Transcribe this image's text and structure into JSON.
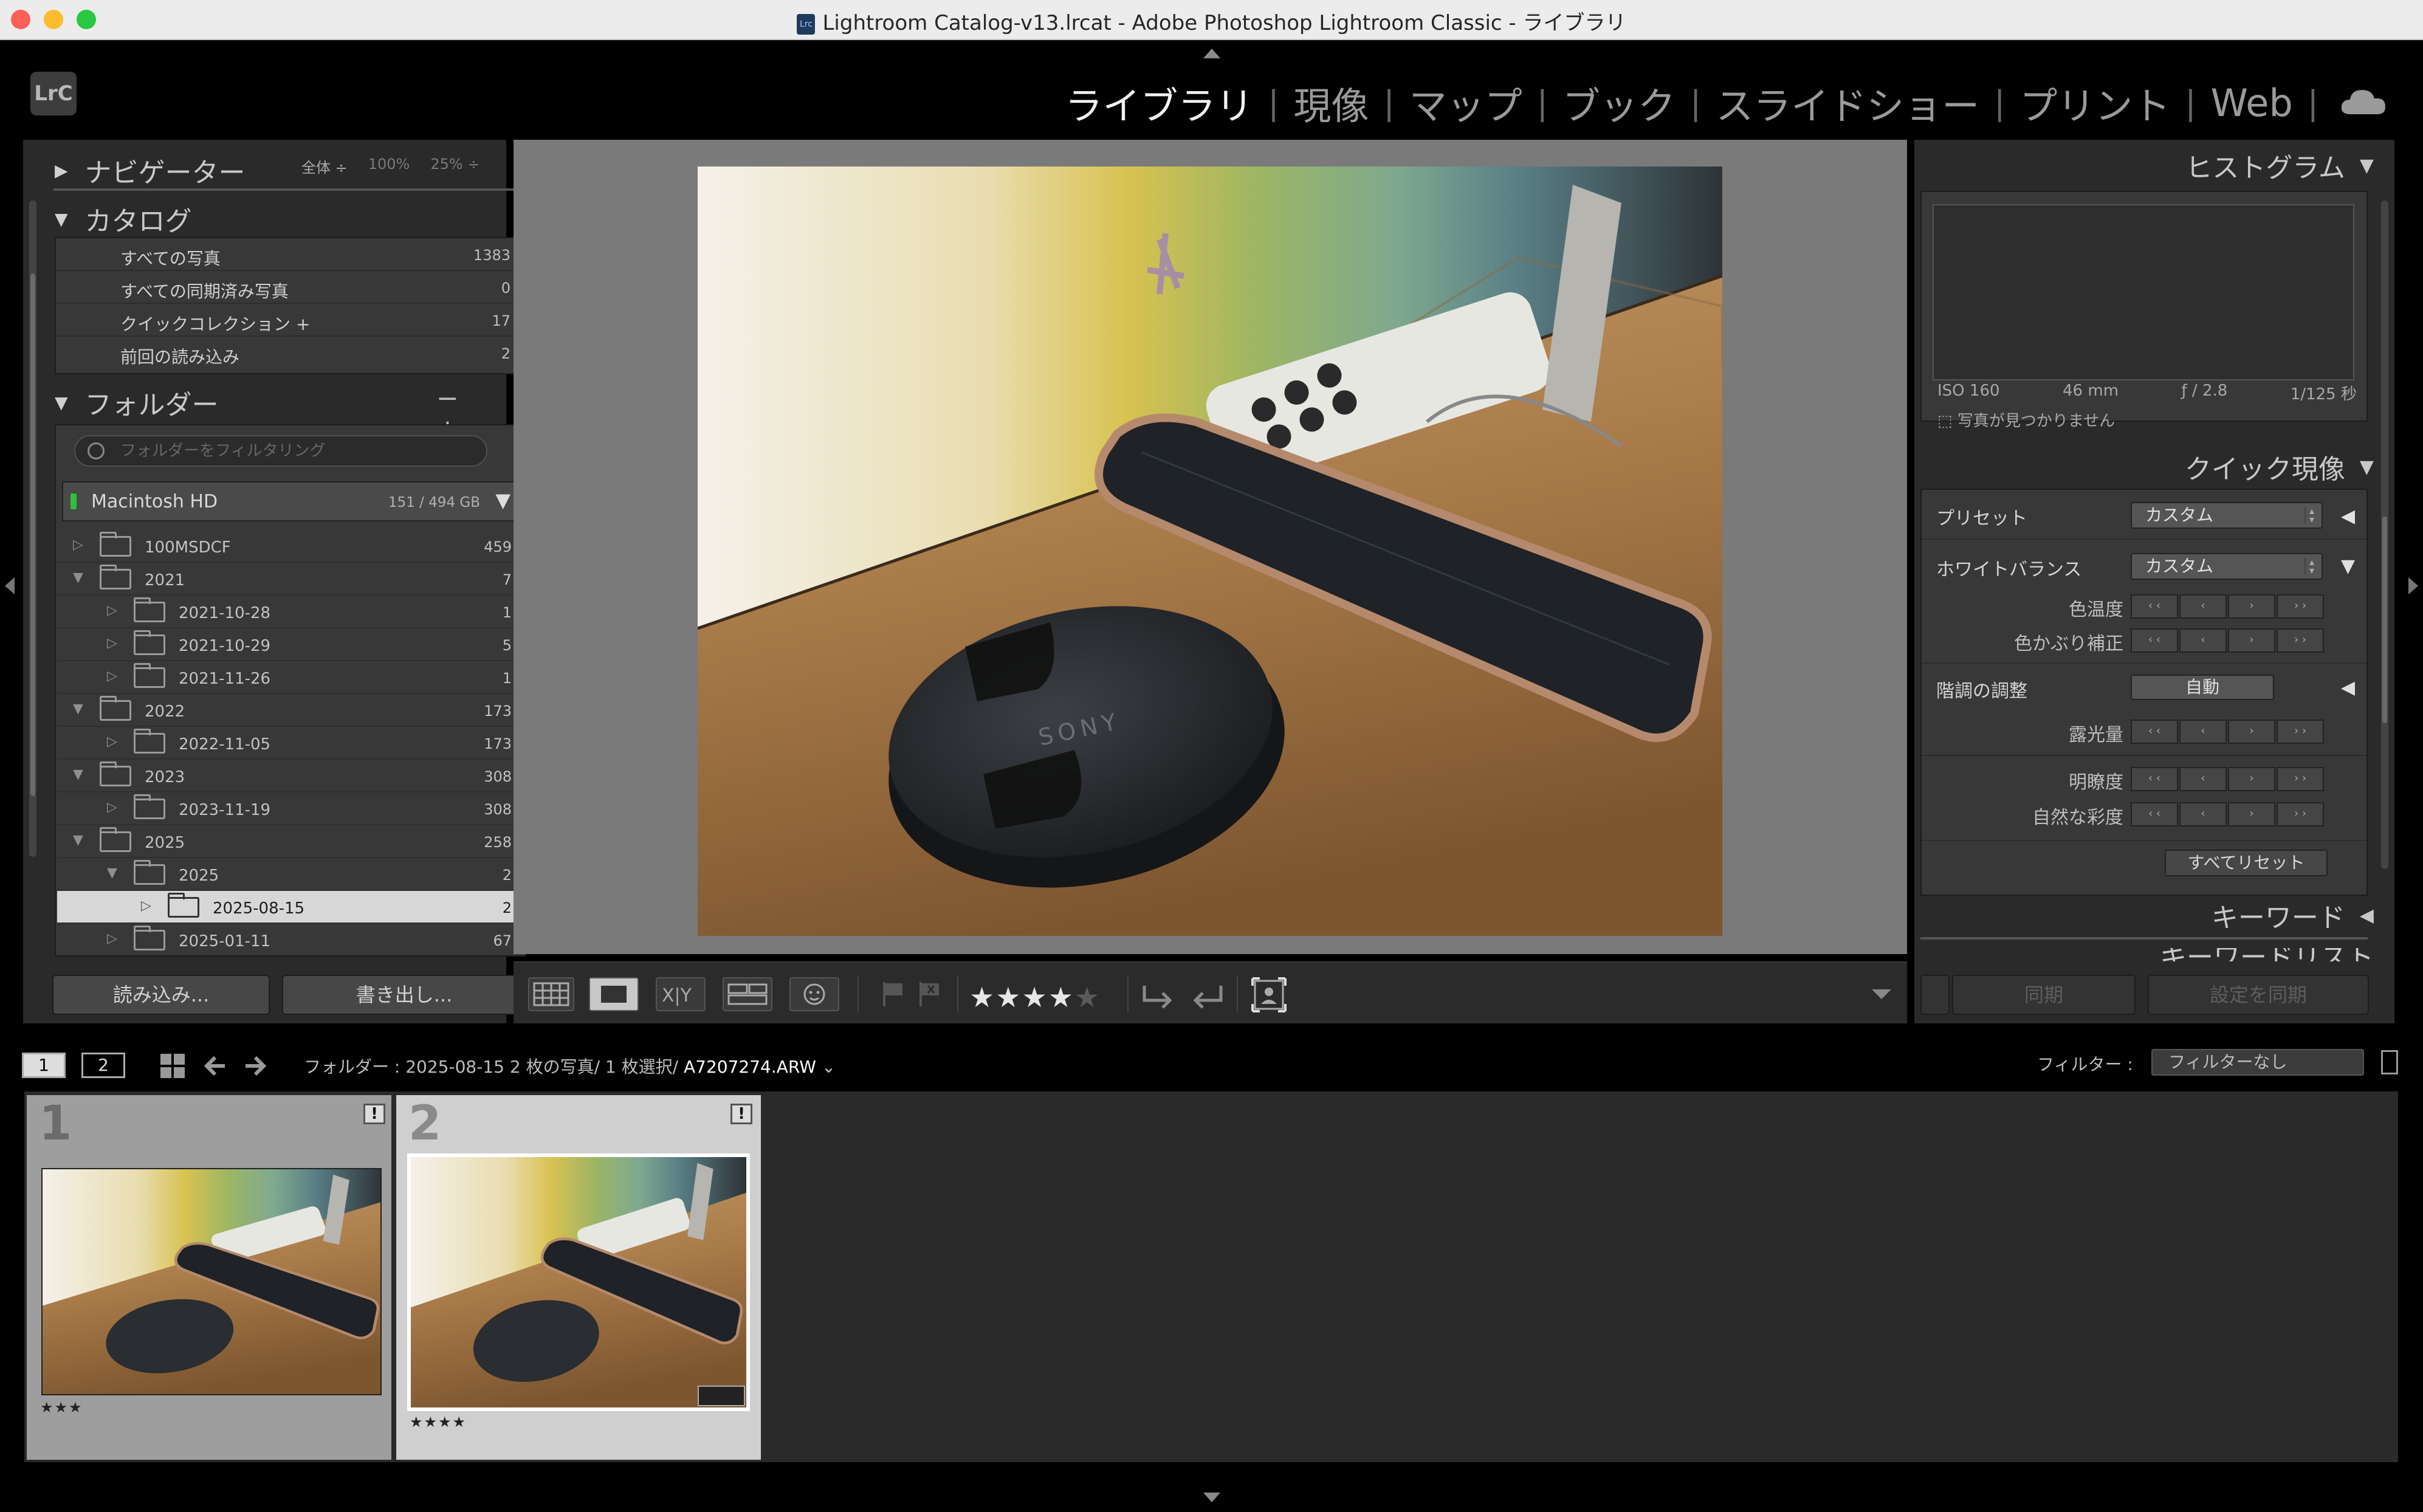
{
  "window": {
    "title": "Lightroom Catalog-v13.lrcat - Adobe Photoshop Lightroom Classic - ライブラリ"
  },
  "app": {
    "logo": "LrC",
    "mini_logo": "Lrc"
  },
  "modules": [
    {
      "label": "ライブラリ",
      "active": true
    },
    {
      "label": "現像"
    },
    {
      "label": "マップ"
    },
    {
      "label": "ブック"
    },
    {
      "label": "スライドショー"
    },
    {
      "label": "プリント"
    },
    {
      "label": "Web"
    }
  ],
  "navigator": {
    "title": "ナビゲーター",
    "zoom_fit": "全体 ÷",
    "zoom_100": "100%",
    "zoom_25": "25% ÷"
  },
  "catalog": {
    "title": "カタログ",
    "items": [
      {
        "label": "すべての写真",
        "count": "1383"
      },
      {
        "label": "すべての同期済み写真",
        "count": "0"
      },
      {
        "label": "クイックコレクション +",
        "count": "17"
      },
      {
        "label": "前回の読み込み",
        "count": "2"
      }
    ]
  },
  "folders": {
    "title": "フォルダー",
    "actions": "− +",
    "filter_placeholder": "フォルダーをフィルタリング",
    "volume": {
      "name": "Macintosh HD",
      "size": "151 / 494 GB"
    },
    "items": [
      {
        "name": "100MSDCF",
        "count": "459",
        "level": 0,
        "expanded": false
      },
      {
        "name": "2021",
        "count": "7",
        "level": 0,
        "expanded": true
      },
      {
        "name": "2021-10-28",
        "count": "1",
        "level": 1,
        "expanded": false
      },
      {
        "name": "2021-10-29",
        "count": "5",
        "level": 1,
        "expanded": false
      },
      {
        "name": "2021-11-26",
        "count": "1",
        "level": 1,
        "expanded": false
      },
      {
        "name": "2022",
        "count": "173",
        "level": 0,
        "expanded": true
      },
      {
        "name": "2022-11-05",
        "count": "173",
        "level": 1,
        "expanded": false
      },
      {
        "name": "2023",
        "count": "308",
        "level": 0,
        "expanded": true
      },
      {
        "name": "2023-11-19",
        "count": "308",
        "level": 1,
        "expanded": false
      },
      {
        "name": "2025",
        "count": "258",
        "level": 0,
        "expanded": true
      },
      {
        "name": "2025",
        "count": "2",
        "level": 1,
        "expanded": true
      },
      {
        "name": "2025-08-15",
        "count": "2",
        "level": 2,
        "expanded": false,
        "selected": true
      },
      {
        "name": "2025-01-11",
        "count": "67",
        "level": 1,
        "expanded": false
      }
    ]
  },
  "left_buttons": {
    "import": "読み込み...",
    "export": "書き出し..."
  },
  "toolbar": {
    "stars": "★★★★",
    "stars_off": "★",
    "rating": 4
  },
  "histogram": {
    "title": "ヒストグラム",
    "iso": "ISO 160",
    "focal": "46 mm",
    "aperture": "ƒ / 2.8",
    "shutter": "1/125 秒",
    "note": "写真が見つかりません"
  },
  "quick_develop": {
    "title": "クイック現像",
    "preset_label": "プリセット",
    "preset_value": "カスタム",
    "wb_label": "ホワイトバランス",
    "wb_value": "カスタム",
    "temp_label": "色温度",
    "tint_label": "色かぶり補正",
    "tone_label": "階調の調整",
    "auto_label": "自動",
    "exposure_label": "露光量",
    "clarity_label": "明瞭度",
    "vibrance_label": "自然な彩度",
    "reset_label": "すべてリセット",
    "step_buttons": [
      "‹ ‹",
      "‹",
      "›",
      "› ›"
    ]
  },
  "keywording": {
    "title": "キーワード",
    "list_title": "キーワードリスト"
  },
  "right_buttons": {
    "sync": "同期",
    "sync_settings": "設定を同期"
  },
  "filmstrip_bar": {
    "screen1": "1",
    "screen2": "2",
    "info": "フォルダー : 2025-08-15   2 枚の写真/ 1 枚選択/",
    "filename": "A7207274.ARW",
    "filter_label": "フィルター :",
    "filter_value": "フィルターなし"
  },
  "filmstrip": [
    {
      "index": "1",
      "stars": "★★★",
      "selected": false
    },
    {
      "index": "2",
      "stars": "★★★★",
      "selected": true
    }
  ]
}
